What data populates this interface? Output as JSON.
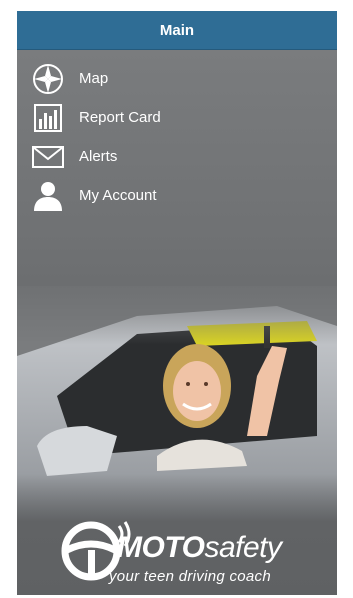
{
  "header": {
    "title": "Main"
  },
  "menu": {
    "items": [
      {
        "label": "Map",
        "icon": "compass-icon"
      },
      {
        "label": "Report Card",
        "icon": "bar-chart-icon"
      },
      {
        "label": "Alerts",
        "icon": "envelope-icon"
      },
      {
        "label": "My Account",
        "icon": "user-icon"
      }
    ]
  },
  "brand": {
    "name_bold": "MOTO",
    "name_light": "safety",
    "tagline": "your teen driving coach"
  },
  "colors": {
    "header_bg": "#2f6d95",
    "panel_bg": "#6f7173",
    "text": "#ffffff"
  }
}
